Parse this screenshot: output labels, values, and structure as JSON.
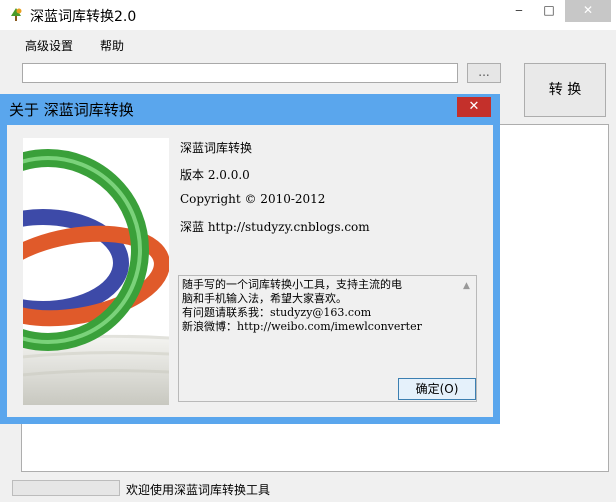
{
  "window": {
    "title": "深蓝词库转换2.0",
    "minimize_glyph": "‒",
    "maximize_glyph": "□",
    "close_glyph": "✕",
    "icon": "app-tree-icon"
  },
  "menu": {
    "items": [
      {
        "label": "高级设置"
      },
      {
        "label": "帮助"
      }
    ]
  },
  "toolbar": {
    "path_value": "",
    "browse_label": "...",
    "convert_label": "转 换"
  },
  "status": {
    "message": "欢迎使用深蓝词库转换工具",
    "progress": 0
  },
  "about": {
    "title": "关于 深蓝词库转换",
    "close_glyph": "✕",
    "product": "深蓝词库转换",
    "version": "版本 2.0.0.0",
    "copyright": "Copyright ©  2010-2012",
    "author": "深蓝 http://studyzy.cnblogs.com",
    "description": [
      "随手写的一个词库转换小工具，支持主流的电",
      "脑和手机输入法，希望大家喜欢。",
      "有问题请联系我：studyzy@163.com",
      "新浪微博：http://weibo.com/imewlconverter"
    ],
    "ok_label": "确定(O)",
    "logo_icon": "interlocking-rings-logo"
  },
  "colors": {
    "dialog_accent": "#5aa6ed",
    "close_red": "#c4302b"
  }
}
